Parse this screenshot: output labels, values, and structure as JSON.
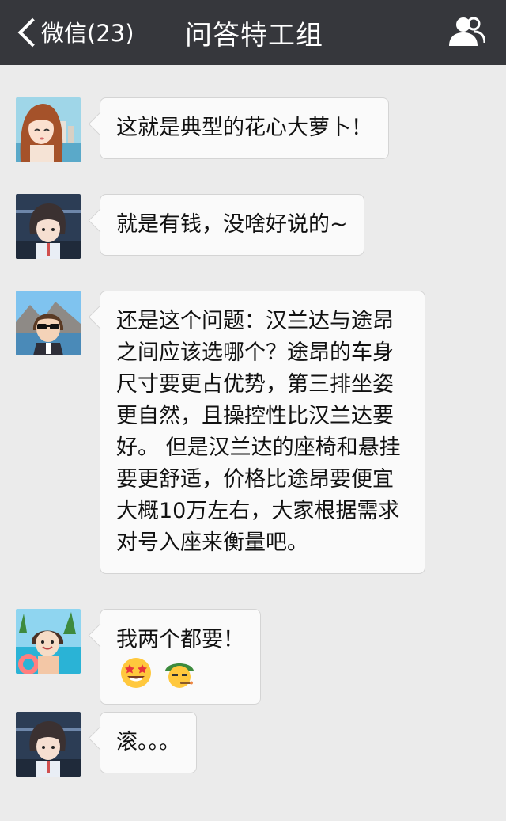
{
  "nav": {
    "back_label": "微信(23)",
    "title": "问答特工组"
  },
  "messages": [
    {
      "avatar": "avatar-girl-icon",
      "text": "这就是典型的花心大萝卜！"
    },
    {
      "avatar": "avatar-boy-dark-icon",
      "text": "就是有钱，没啥好说的~"
    },
    {
      "avatar": "avatar-sunglasses-man-icon",
      "text": "还是这个问题：汉兰达与途昂之间应该选哪个？途昂的车身尺寸要更占优势，第三排坐姿更自然，且操控性比汉兰达要好。 但是汉兰达的座椅和悬挂要更舒适，价格比途昂要便宜大概10万左右，大家根据需求对号入座来衡量吧。"
    },
    {
      "avatar": "avatar-beach-boy-icon",
      "text": "我两个都要！",
      "emojis": [
        "star-struck-emoji",
        "cowboy-emoji"
      ]
    },
    {
      "avatar": "avatar-boy-dark-icon",
      "text": "滚。。。"
    }
  ],
  "colors": {
    "nav_bg": "#36373c",
    "chat_bg": "#ebebeb",
    "bubble_bg": "#fafafa"
  }
}
